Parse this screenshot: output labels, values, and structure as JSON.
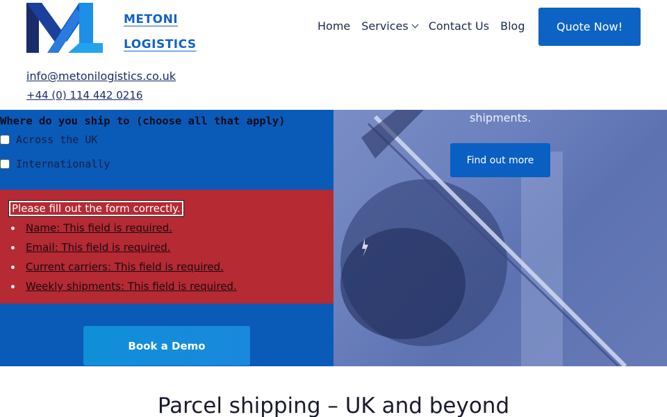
{
  "brand": {
    "line1": "METONI",
    "line2": "LOGISTICS",
    "color": "#1162c4"
  },
  "nav": {
    "home": "Home",
    "services": "Services",
    "contact": "Contact Us",
    "blog": "Blog",
    "quote": "Quote Now!"
  },
  "contact": {
    "email": "info@metonilogistics.co.uk",
    "phone": "+44 (0) 114 442 0216"
  },
  "form": {
    "question": "Where do you ship to (choose all that apply)",
    "options": [
      "Across the UK",
      "Internationally"
    ]
  },
  "errors": {
    "title": "Please fill out the form correctly.",
    "items": [
      "Name: This field is required.",
      "Email: This field is required.",
      "Current carriers: This field is required.",
      "Weekly shipments: This field is required."
    ]
  },
  "hero_right": {
    "text": "shipments.",
    "button": "Find out more"
  },
  "demo": {
    "button": "Book a Demo"
  },
  "section": {
    "title": "Parcel shipping – UK and beyond"
  },
  "colors": {
    "primary": "#0a5ab8",
    "error": "#b52a33",
    "accent": "#0d63c4"
  }
}
